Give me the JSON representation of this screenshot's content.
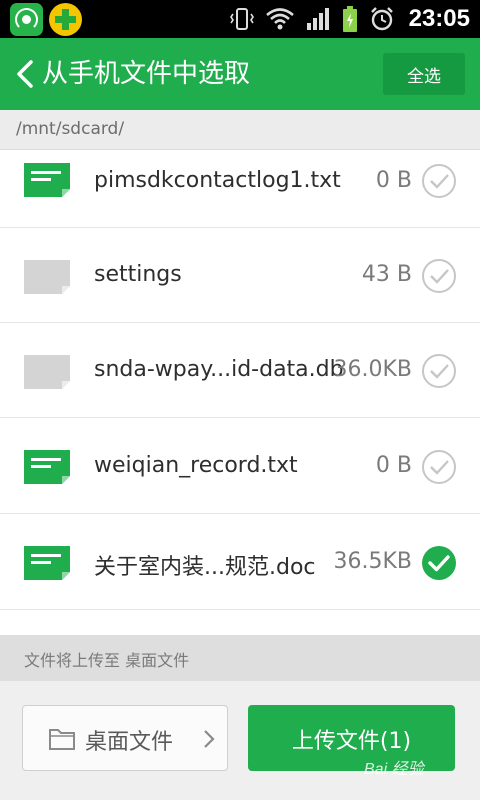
{
  "status_bar": {
    "time": "23:05",
    "icons": [
      "app-wifi-share-icon",
      "app-360-plus-icon",
      "vibrate-icon",
      "wifi-icon",
      "signal-icon",
      "battery-icon",
      "alarm-icon"
    ]
  },
  "header": {
    "back_icon": "chevron-left-icon",
    "title": "从手机文件中选取",
    "select_all": "全选"
  },
  "path": "/mnt/sdcard/",
  "files": [
    {
      "name": "pimsdkcontactlog1.txt",
      "size": "0 B",
      "type": "document",
      "checked": false
    },
    {
      "name": "settings",
      "size": "43 B",
      "type": "unknown",
      "checked": false
    },
    {
      "name": "snda-wpay...id-data.db",
      "size": "36.0KB",
      "type": "unknown",
      "checked": false
    },
    {
      "name": "weiqian_record.txt",
      "size": "0 B",
      "type": "document",
      "checked": false
    },
    {
      "name": "关于室内装...规范.doc",
      "size": "36.5KB",
      "type": "document",
      "checked": true
    }
  ],
  "footer": {
    "destination_text": "文件将上传至 桌面文件",
    "folder_button": "桌面文件",
    "upload_button": "上传文件(1)"
  },
  "watermark": "Bai 经验",
  "colors": {
    "accent": "#1fad4d",
    "accent_dark": "#169a41",
    "unknown_file": "#d4d4d4"
  }
}
